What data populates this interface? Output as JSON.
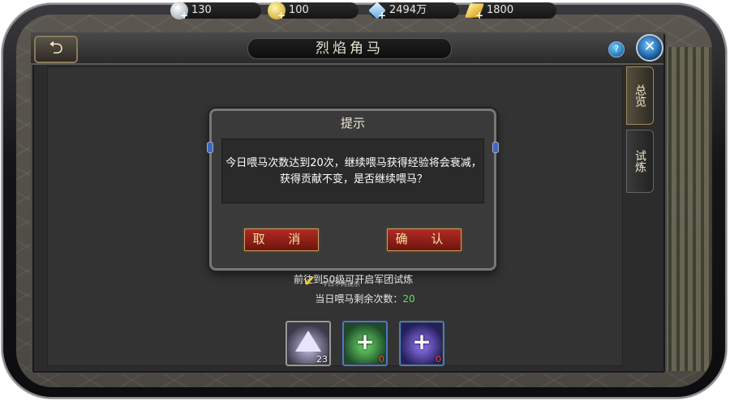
{
  "currencies": [
    {
      "icon": "silver-coin-icon",
      "value": "130",
      "color": "#c9d4e0"
    },
    {
      "icon": "gold-coin-icon",
      "value": "100",
      "color": "#f0c830"
    },
    {
      "icon": "diamond-icon",
      "value": "2494万",
      "color": "#a9d8ff"
    },
    {
      "icon": "gold-ingot-icon",
      "value": "1800",
      "color": "#f5c020"
    }
  ],
  "header": {
    "title": "烈焰角马",
    "back_icon": "back-arrow-icon",
    "help_icon": "help-icon",
    "close_icon": "close-icon"
  },
  "side_tabs": [
    {
      "label": "总览",
      "active": true
    },
    {
      "label": "试炼",
      "active": false
    }
  ],
  "dialog": {
    "title": "提示",
    "message": "今日喂马次数达到20次，继续喂马获得经验将会衰减，获得贡献不变，是否继续喂马？",
    "cancel_label": "取 消",
    "confirm_label": "确 认"
  },
  "notice": {
    "level_text": "前往到50级可开启军团试炼",
    "dont_show_text": "今日不再提示",
    "remain_label": "当日喂马剩余次数：",
    "remain_value": "20"
  },
  "items": [
    {
      "icon": "crystal-icon",
      "count": "23"
    },
    {
      "icon": "green-feed-add-icon",
      "count": "0"
    },
    {
      "icon": "purple-feed-add-icon",
      "count": "0"
    }
  ]
}
